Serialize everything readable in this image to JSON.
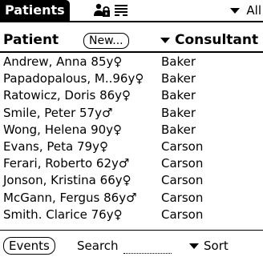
{
  "titlebar": {
    "title": "Patients",
    "icons": [
      "person-lock-icon",
      "filter-lines-icon"
    ],
    "category_label": "All"
  },
  "header": {
    "patient_label": "Patient",
    "new_button": "New...",
    "consultant_label": "Consultant"
  },
  "patients": [
    {
      "name": "Andrew, Anna 85y♀",
      "consultant": "Baker"
    },
    {
      "name": "Papadopalous, M..96y♀",
      "consultant": "Baker"
    },
    {
      "name": "Ratowicz, Doris 86y♀",
      "consultant": "Baker"
    },
    {
      "name": "Smile, Peter 57y♂",
      "consultant": "Baker"
    },
    {
      "name": "Wong, Helena 90y♀",
      "consultant": "Baker"
    },
    {
      "name": "Evans, Peta 79y♀",
      "consultant": "Carson"
    },
    {
      "name": "Ferari, Roberto 62y♂",
      "consultant": "Carson"
    },
    {
      "name": "Jonson, Kristina 66y♀",
      "consultant": "Carson"
    },
    {
      "name": "McGann, Fergus 86y♂",
      "consultant": "Carson"
    },
    {
      "name": "Smith. Clarice 76y♀",
      "consultant": "Carson"
    }
  ],
  "footer": {
    "events_button": "Events",
    "search_label": "Search",
    "search_value": "",
    "sort_label": "Sort"
  }
}
